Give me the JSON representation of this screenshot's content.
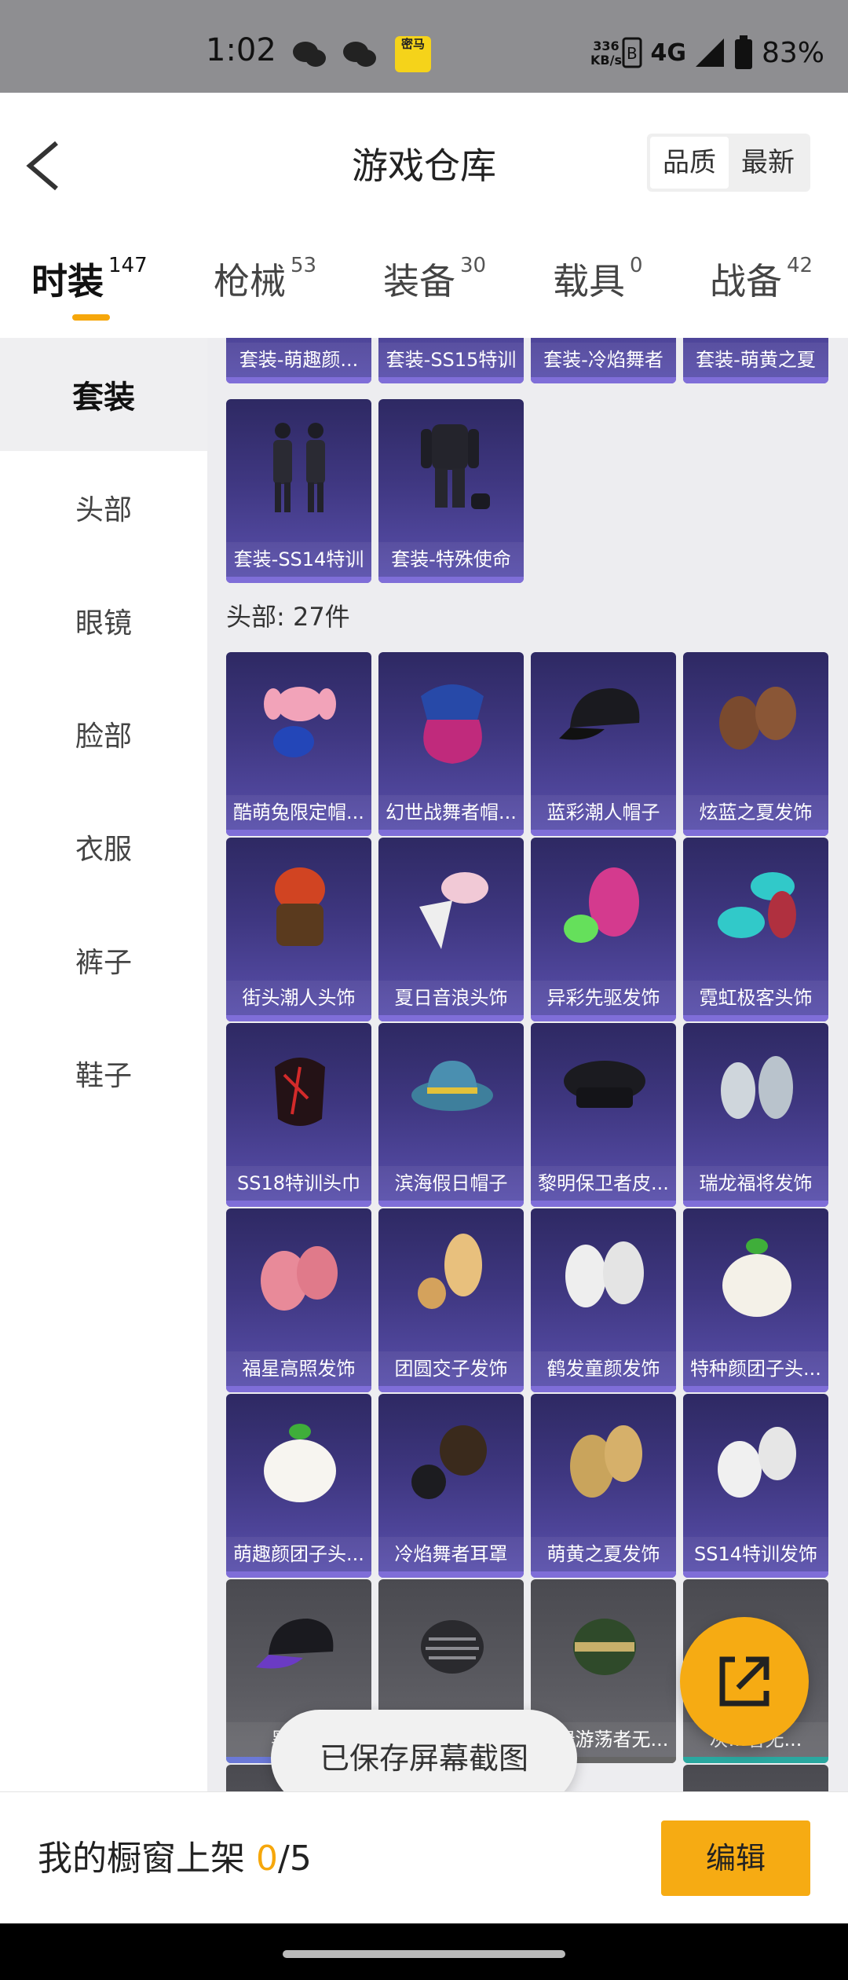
{
  "status_bar": {
    "time": "1:02",
    "mima_label": "密马",
    "net_speed": "336",
    "net_unit": "KB/s",
    "network": "4G",
    "battery": "83%"
  },
  "header": {
    "title": "游戏仓库",
    "sort_options": [
      "品质",
      "最新"
    ],
    "sort_selected": "品质"
  },
  "tabs": [
    {
      "label": "时装",
      "count": "147"
    },
    {
      "label": "枪械",
      "count": "53"
    },
    {
      "label": "装备",
      "count": "30"
    },
    {
      "label": "载具",
      "count": "0"
    },
    {
      "label": "战备",
      "count": "42"
    }
  ],
  "sidebar": {
    "items": [
      "套装",
      "头部",
      "眼镜",
      "脸部",
      "衣服",
      "裤子",
      "鞋子"
    ]
  },
  "suits": {
    "items": [
      "套装-萌趣颜...",
      "套装-SS15特训",
      "套装-冷焰舞者",
      "套装-萌黄之夏",
      "套装-SS14特训",
      "套装-特殊使命"
    ]
  },
  "head_section": {
    "title": "头部: 27件",
    "items": [
      "酷萌兔限定帽...",
      "幻世战舞者帽...",
      "蓝彩潮人帽子",
      "炫蓝之夏发饰",
      "街头潮人头饰",
      "夏日音浪头饰",
      "异彩先驱发饰",
      "霓虹极客头饰",
      "SS18特训头巾",
      "滨海假日帽子",
      "黎明保卫者皮...",
      "瑞龙福将发饰",
      "福星高照发饰",
      "团圆交子发饰",
      "鹤发童颜发饰",
      "特种颜团子头...",
      "萌趣颜团子头...",
      "冷焰舞者耳罩",
      "萌黄之夏发饰",
      "SS14特训发饰",
      "黑紫...",
      "",
      "...绿游荡者无...",
      "灰...者无..."
    ]
  },
  "toast": "已保存屏幕截图",
  "bottom": {
    "showcase_label": "我的橱窗上架 ",
    "showcase_used": "0",
    "showcase_total": "/5",
    "edit_label": "编辑"
  },
  "colors": {
    "accent": "#f6ab13",
    "card_purple": "#3f3781",
    "card_grey": "#5b5b61"
  }
}
